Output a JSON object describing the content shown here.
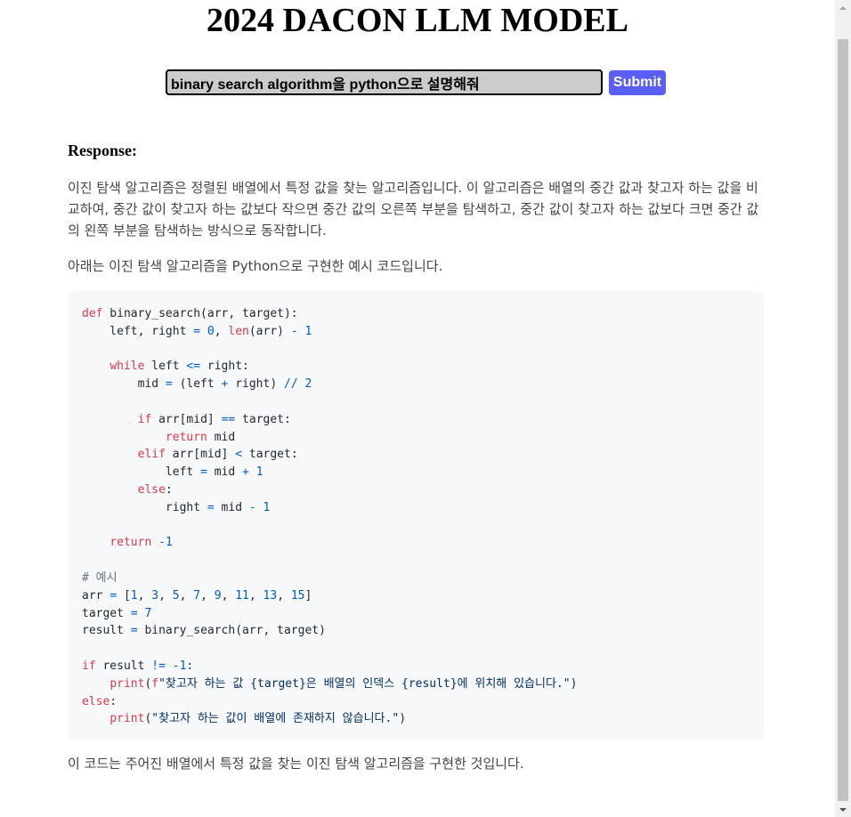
{
  "header": {
    "title": "2024 DACON LLM MODEL"
  },
  "form": {
    "query_value": "binary search algorithm을 python으로 설명해줘",
    "submit_label": "Submit"
  },
  "response": {
    "heading": "Response:",
    "paragraph_1": "이진 탐색 알고리즘은 정렬된 배열에서 특정 값을 찾는 알고리즘입니다. 이 알고리즘은 배열의 중간 값과 찾고자 하는 값을 비교하여, 중간 값이 찾고자 하는 값보다 작으면 중간 값의 오른쪽 부분을 탐색하고, 중간 값이 찾고자 하는 값보다 크면 중간 값의 왼쪽 부분을 탐색하는 방식으로 동작합니다.",
    "paragraph_2": "아래는 이진 탐색 알고리즘을 Python으로 구현한 예시 코드입니다.",
    "code_lines": [
      "def binary_search(arr, target):",
      "    left, right = 0, len(arr) - 1",
      "",
      "    while left <= right:",
      "        mid = (left + right) // 2",
      "",
      "        if arr[mid] == target:",
      "            return mid",
      "        elif arr[mid] < target:",
      "            left = mid + 1",
      "        else:",
      "            right = mid - 1",
      "",
      "    return -1",
      "",
      "# 예시",
      "arr = [1, 3, 5, 7, 9, 11, 13, 15]",
      "target = 7",
      "result = binary_search(arr, target)",
      "",
      "if result != -1:",
      "    print(f\"찾고자 하는 값 {target}은 배열의 인덱스 {result}에 위치해 있습니다.\")",
      "else:",
      "    print(\"찾고자 하는 값이 배열에 존재하지 않습니다.\")"
    ],
    "paragraph_3": "이 코드는 주어진 배열에서 특정 값을 찾는 이진 탐색 알고리즘을 구현한 것입니다."
  },
  "colors": {
    "submit_button": "#5a5ef5",
    "input_background": "#cccccc",
    "code_background": "#f6f8fa",
    "keyword": "#d73a49",
    "builtin": "#005cc5",
    "string": "#032f62",
    "comment": "#6a737d"
  }
}
